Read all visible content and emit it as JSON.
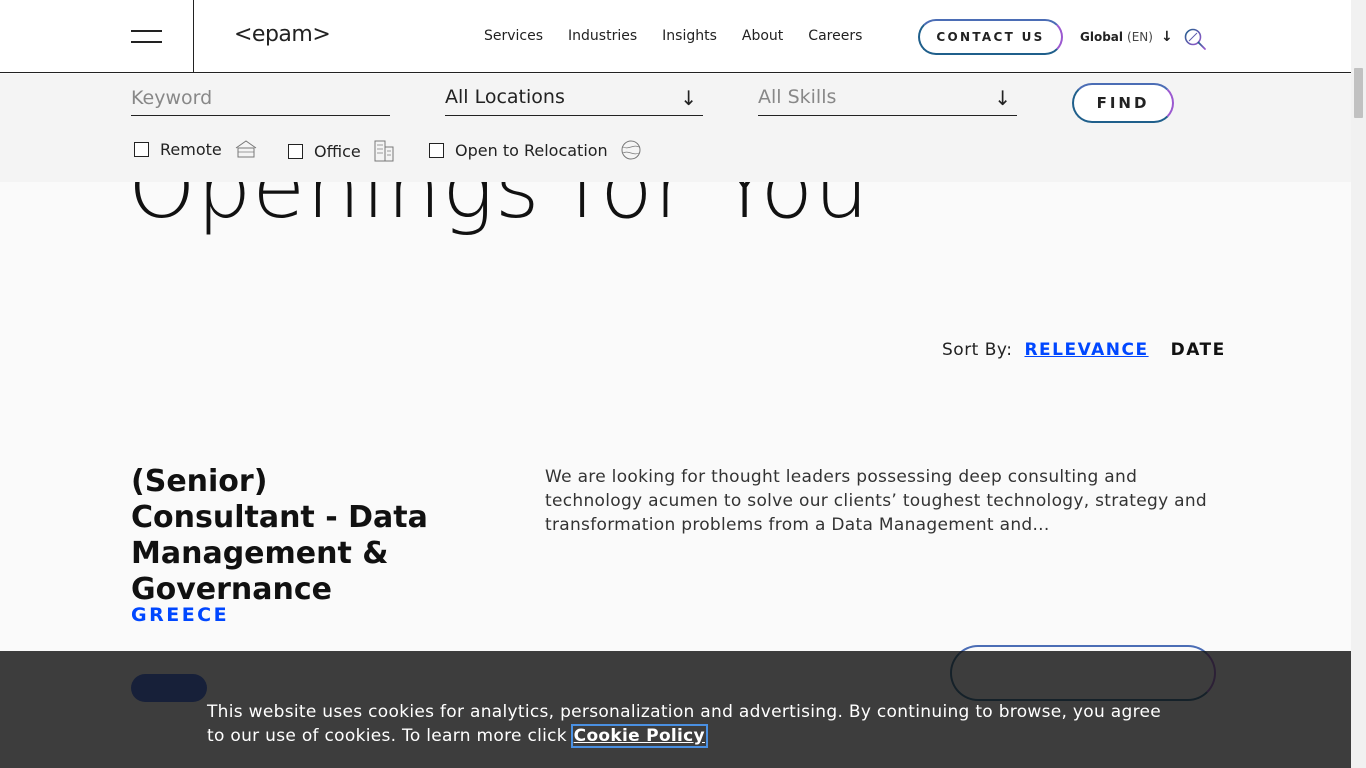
{
  "header": {
    "logo": "<epam>",
    "nav": [
      "Services",
      "Industries",
      "Insights",
      "About",
      "Careers"
    ],
    "contact_label": "CONTACT US",
    "global_label": "Global",
    "lang_label": "(EN)"
  },
  "filters": {
    "keyword_placeholder": "Keyword",
    "location_value": "All Locations",
    "skills_value": "All Skills",
    "find_label": "FIND",
    "checkboxes": {
      "remote": "Remote",
      "office": "Office",
      "relocation": "Open to Relocation"
    }
  },
  "page": {
    "heading": "Openings for You"
  },
  "sort": {
    "label": "Sort By:",
    "relevance": "RELEVANCE",
    "date": "DATE"
  },
  "job": {
    "title": "(Senior) Consultant - Data Management & Governance",
    "description": "We are looking for thought leaders possessing deep consulting and technology acumen to solve our clients’ toughest technology, strategy and transformation problems from a Data Management and...",
    "location": "GREECE"
  },
  "cookie": {
    "text": "This website uses cookies for analytics, personalization and advertising. By continuing to browse, you agree to our use of cookies. To learn more click ",
    "link": "Cookie Policy"
  },
  "colors": {
    "accent_blue": "#0047ff",
    "gradient_start": "#1f5f8b",
    "gradient_end": "#9b59d0"
  }
}
